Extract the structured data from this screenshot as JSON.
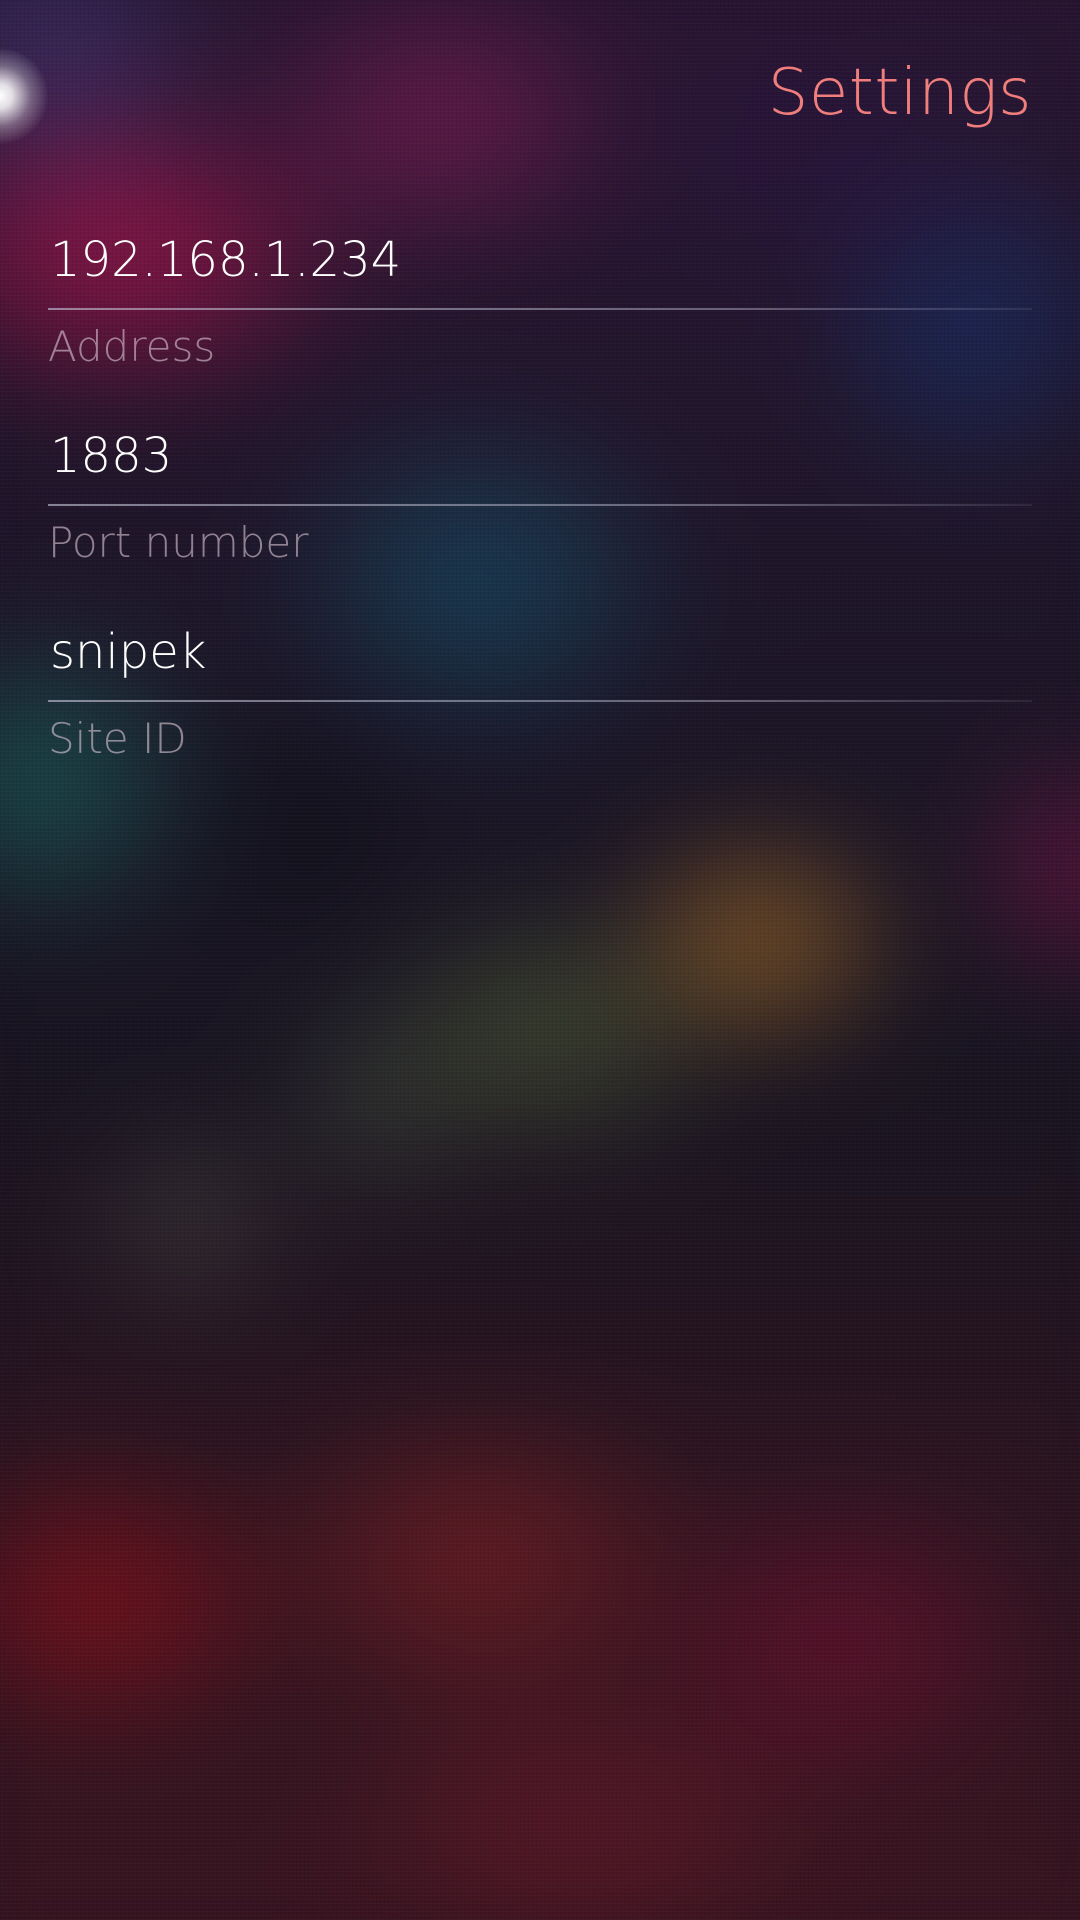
{
  "page": {
    "title": "Settings"
  },
  "fields": [
    {
      "value": "192.168.1.234",
      "label": "Address"
    },
    {
      "value": "1883",
      "label": "Port number"
    },
    {
      "value": "snipek",
      "label": "Site ID"
    }
  ],
  "colors": {
    "title": "#f07e7c",
    "input_text": "#ffffff",
    "label_text": "#d7c3d2"
  }
}
